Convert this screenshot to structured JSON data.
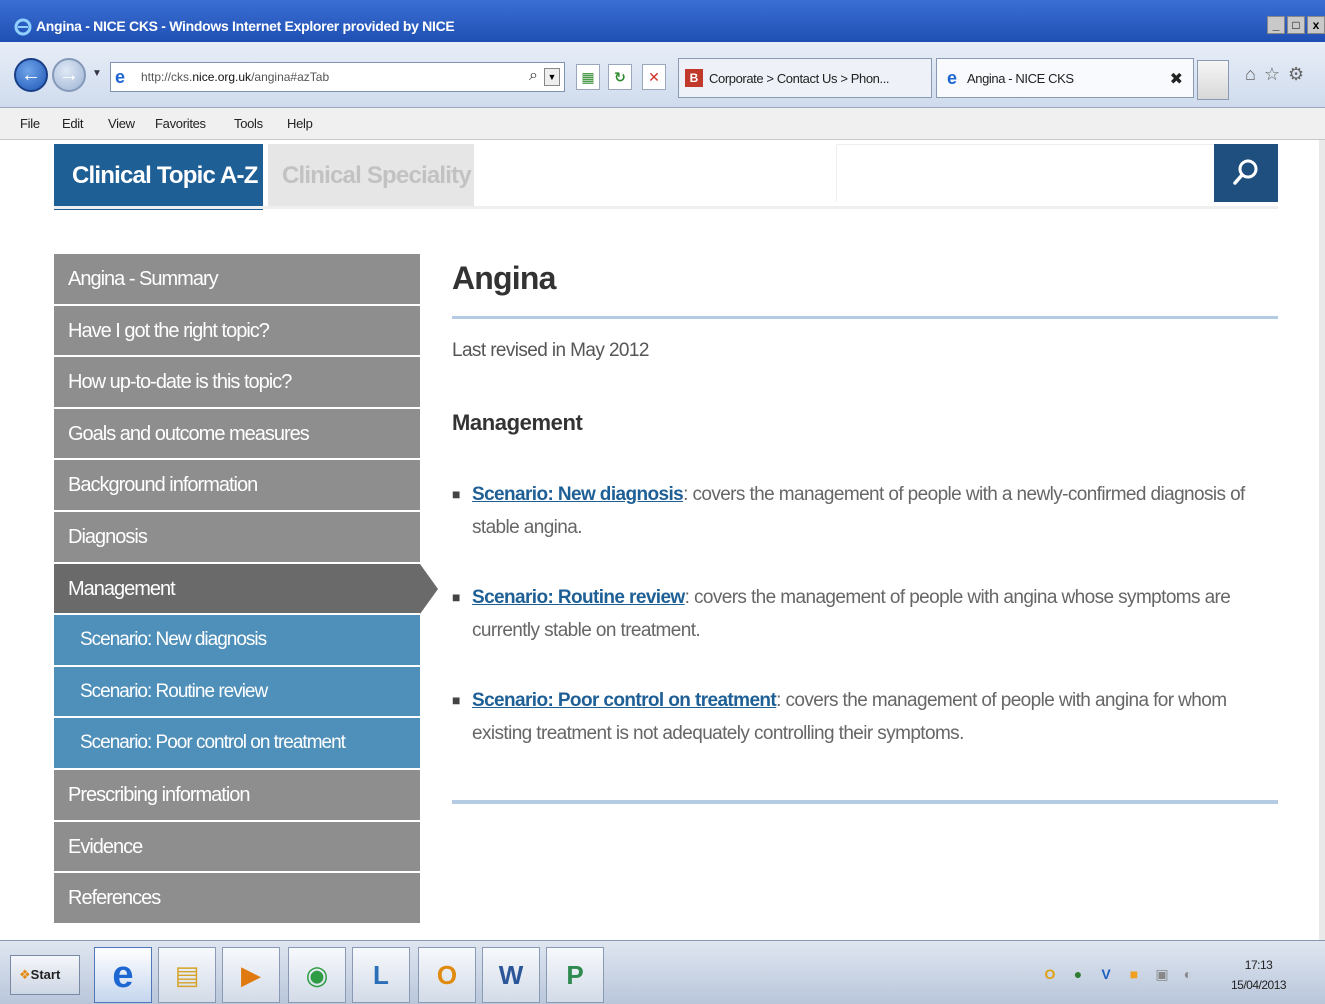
{
  "window": {
    "title": "Angina - NICE CKS - Windows Internet Explorer provided by NICE",
    "controls": [
      "_",
      "□",
      "x"
    ]
  },
  "navbar": {
    "back_glyph": "←",
    "forward_glyph": "→",
    "dropdown_glyph": "▼",
    "url_prefix": "http://cks.",
    "url_domain": "nice.org.uk",
    "url_suffix": "/angina#azTab",
    "search_glyph": "⌕",
    "tabs": [
      {
        "label": "Corporate > Contact Us > Phon...",
        "icon": "B",
        "icon_color": "#c0392b"
      },
      {
        "label": "Angina - NICE CKS",
        "icon": "e",
        "icon_color": "#1e67d2",
        "close": "✖"
      }
    ],
    "right_icons": "⌂☆⚙"
  },
  "menu": [
    "File",
    "Edit",
    "View",
    "Favorites",
    "Tools",
    "Help"
  ],
  "site_tabs": {
    "active": "Clinical Topic A-Z",
    "inactive": "Clinical Speciality",
    "search_placeholder": ""
  },
  "sidebar": {
    "items": [
      {
        "label": "Angina - Summary",
        "type": "normal"
      },
      {
        "label": "Have I got the right topic?",
        "type": "normal"
      },
      {
        "label": "How up-to-date is this topic?",
        "type": "normal"
      },
      {
        "label": "Goals and outcome measures",
        "type": "normal"
      },
      {
        "label": "Background information",
        "type": "normal"
      },
      {
        "label": "Diagnosis",
        "type": "normal"
      },
      {
        "label": "Management",
        "type": "active"
      },
      {
        "label": "Scenario: New diagnosis",
        "type": "sub"
      },
      {
        "label": "Scenario: Routine review",
        "type": "sub"
      },
      {
        "label": "Scenario: Poor control on treatment",
        "type": "sub"
      },
      {
        "label": "Prescribing information",
        "type": "normal"
      },
      {
        "label": "Evidence",
        "type": "normal"
      },
      {
        "label": "References",
        "type": "normal"
      }
    ]
  },
  "main": {
    "title": "Angina",
    "revised": "Last revised in May 2012",
    "section_heading": "Management",
    "bullets": [
      {
        "link": "Scenario: New diagnosis",
        "text": ": covers the management of people with a newly-confirmed diagnosis of stable angina."
      },
      {
        "link": "Scenario: Routine review",
        "text": ": covers the management of people with angina whose symptoms are currently stable on treatment."
      },
      {
        "link": "Scenario: Poor control on treatment",
        "text": ": covers the management of people with angina for whom existing treatment is not adequately controlling their symptoms."
      }
    ]
  },
  "taskbar": {
    "start_label": "Start",
    "apps": [
      {
        "name": "internet-explorer",
        "glyph": "e",
        "color": "#1e67d2",
        "selected": true
      },
      {
        "name": "file-explorer",
        "glyph": "▤",
        "color": "#d6a32a"
      },
      {
        "name": "media-player",
        "glyph": "▶",
        "color": "#e07a10"
      },
      {
        "name": "chrome",
        "glyph": "◉",
        "color": "#2e9c44"
      },
      {
        "name": "lync",
        "glyph": "L",
        "color": "#2a6fb8"
      },
      {
        "name": "outlook",
        "glyph": "O",
        "color": "#e08a0e"
      },
      {
        "name": "word",
        "glyph": "W",
        "color": "#2b579a"
      },
      {
        "name": "project",
        "glyph": "P",
        "color": "#2e8a4e"
      }
    ],
    "tray_icons": [
      {
        "glyph": "O",
        "color": "#e0a010"
      },
      {
        "glyph": "●",
        "color": "#2e7d32"
      },
      {
        "glyph": "V",
        "color": "#1e5fbf"
      },
      {
        "glyph": "■",
        "color": "#f0a020"
      },
      {
        "glyph": "▣",
        "color": "#888888"
      },
      {
        "glyph": "◐",
        "color": "#888888"
      }
    ],
    "time": "17:13",
    "date": "15/04/2013"
  }
}
